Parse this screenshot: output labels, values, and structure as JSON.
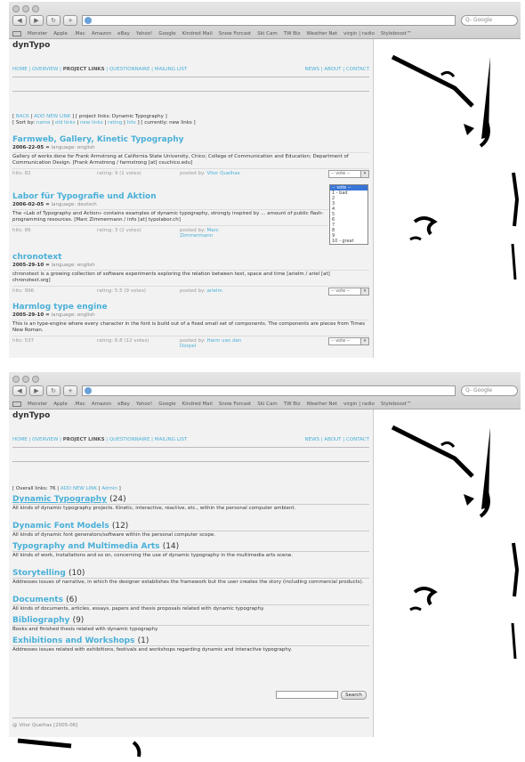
{
  "browser": {
    "search_placeholder": "Q- Google",
    "bookmarks": [
      "Monster",
      "Apple",
      ".Mac",
      "Amazon",
      "eBay",
      "Yahoo!",
      "Google",
      "Kindred Mail",
      "Snow Forcast",
      "Ski Cam",
      "TW Biz",
      "Weather Net",
      "virgin | radio",
      "Styleboost™"
    ]
  },
  "site": {
    "logo": "dynTypo",
    "nav_left": [
      "HOME",
      "OVERVIEW",
      "PROJECT LINKS",
      "QUESTIONNAIRE",
      "MAILING LIST"
    ],
    "nav_right": [
      "NEWS",
      "ABOUT",
      "CONTACT"
    ]
  },
  "page1": {
    "crumb_line1_links": [
      "BACK",
      "ADD NEW LINK"
    ],
    "crumb_line1_text": "[ project links: Dynamic Typography ]",
    "crumb_line2_label": "[ Sort by:",
    "crumb_line2_links": [
      "name",
      "old links",
      "new links",
      "rating",
      "hits"
    ],
    "crumb_line2_current": "] [ currently: new links ]",
    "entries": [
      {
        "title": "Farmweb, Gallery, Kinetic Typography",
        "date": "2006-22-05",
        "lang": "language: english",
        "desc": "Gallery of works done for Frank Armstrong at California State University, Chico; College of Communication and Education; Department of Communication Design. [Frank Armstrong / farmstrong [at] csuchico.edu]",
        "hits": "hits: 82",
        "rating": "rating: 9 (1 votes)",
        "posted_label": "posted by:",
        "poster": "Vitor Quelhas"
      },
      {
        "title": "Labor für Typografie und Aktion",
        "date": "2006-02-05",
        "lang": "language: deutsch",
        "desc": "The «Lab of Typography and Action» contains examples of dynamic typography, strongly inspired by ... amount of public flash-programming resources. [Marc Zimmermann / info [at] typolabor.ch]",
        "hits": "hits: 86",
        "rating": "rating: 3 (2 votes)",
        "posted_label": "posted by:",
        "poster": "Marc Zimmermann"
      },
      {
        "title": "chronotext",
        "date": "2005-29-10",
        "lang": "language: english",
        "desc": "chronotext is a growing collection of software experiments exploring the relation between text, space and time [arielm / ariel [at] chronotext.org]",
        "hits": "hits: 996",
        "rating": "rating: 5.5 (9 votes)",
        "posted_label": "posted by:",
        "poster": "arielm"
      },
      {
        "title": "Harmlog type engine",
        "date": "2005-29-10",
        "lang": "language: english",
        "desc": "This is an type-engine where every character in the font is build out of a fixed small set of components. The components are pieces from Times New Roman.",
        "hits": "hits: 537",
        "rating": "rating: 6.8 (12 votes)",
        "posted_label": "posted by:",
        "poster": "Harm van den Dorpel"
      }
    ],
    "vote_label": "-- vote --",
    "vote_options": [
      "-- vote --",
      "1 - bad",
      "2",
      "3",
      "4",
      "5",
      "6",
      "7",
      "8",
      "9",
      "10 - great"
    ]
  },
  "page2": {
    "overall_prefix": "[ Overall links: 76 |",
    "overall_links": [
      "ADD NEW LINK",
      "Admin"
    ],
    "overall_suffix": "]",
    "categories": [
      {
        "title": "Dynamic Typography",
        "count": "(24)",
        "desc": "All kinds of dynamic typography projects. Kinetic, interactive, reactive, etc., within the personal computer ambient."
      },
      {
        "title": "Dynamic Font Models",
        "count": "(12)",
        "desc": "All kinds of dynamic font generators/software within the personal computer scope."
      },
      {
        "title": "Typography and Multimedia Arts",
        "count": "(14)",
        "desc": "All kinds of work, installations and so on, concerning the use of dynamic typography in the multimedia arts scene."
      },
      {
        "title": "Storytelling",
        "count": "(10)",
        "desc": "Addresses issues of narrative, in which the designer establishes the framework but the user creates the story (including commercial products)."
      },
      {
        "title": "Documents",
        "count": "(6)",
        "desc": "All kinds of documents, articles, essays, papers and thesis proposals related with dynamic typography."
      },
      {
        "title": "Bibliography",
        "count": "(9)",
        "desc": "Books and finished thesis related with dynamic typography"
      },
      {
        "title": "Exhibitions and Workshops",
        "count": "(1)",
        "desc": "Addresses issues related with exhibitions, festivals and workshops regarding dynamic and interactive typography."
      }
    ],
    "search_button": "Search",
    "footer": "@ Vitor Quelhas [2005-06]"
  }
}
